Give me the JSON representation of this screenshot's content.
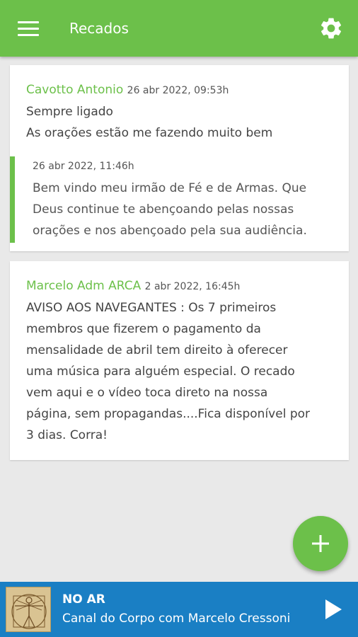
{
  "appbar": {
    "title": "Recados",
    "menu_icon": "menu-icon",
    "settings_icon": "gear-icon"
  },
  "messages": [
    {
      "author": "Cavotto Antonio",
      "date": "26 abr 2022, 09:53h",
      "lines": [
        "Sempre ligado",
        "As orações estão me fazendo muito bem"
      ],
      "reply": {
        "date": "26 abr 2022, 11:46h",
        "lines": [
          "Bem vindo meu irmão de Fé e de Armas. Que",
          "Deus continue te abençoando pelas nossas",
          "orações e nos abençoado pela sua audiência."
        ]
      }
    },
    {
      "author": "Marcelo Adm ARCA",
      "date": "2 abr 2022, 16:45h",
      "lines": [
        "AVISO AOS NAVEGANTES :  Os 7 primeiros",
        "membros que fizerem o pagamento da",
        "mensalidade de abril tem direito à oferecer",
        "uma música para alguém especial.  O recado",
        "vem aqui e o vídeo toca direto na nossa",
        "página, sem propagandas....Fica disponível por",
        "3 dias.   Corra!"
      ]
    }
  ],
  "fab": {
    "icon": "plus-icon"
  },
  "player": {
    "status": "NO AR",
    "show": "Canal do Corpo com Marcelo Cressoni",
    "play_icon": "play-icon"
  },
  "colors": {
    "primary": "#6cc04a",
    "player_bg": "#1a7fc4",
    "background": "#e9e9e9"
  }
}
